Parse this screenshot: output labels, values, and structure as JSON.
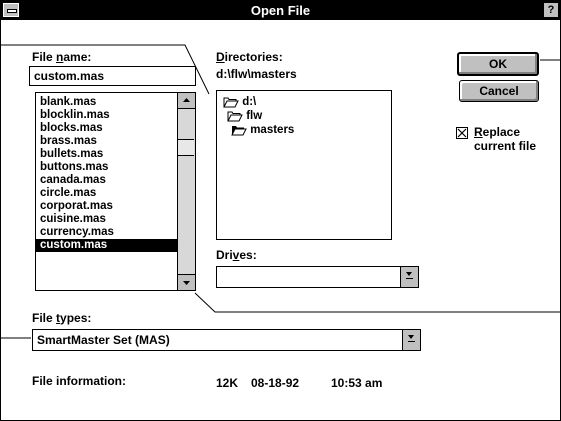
{
  "window": {
    "title": "Open File"
  },
  "file_name": {
    "label_pre": "File ",
    "label_u": "n",
    "label_post": "ame:",
    "value": "custom.mas",
    "items": [
      "blank.mas",
      "blocklin.mas",
      "blocks.mas",
      "brass.mas",
      "bullets.mas",
      "buttons.mas",
      "canada.mas",
      "circle.mas",
      "corporat.mas",
      "cuisine.mas",
      "currency.mas",
      "custom.mas"
    ],
    "selected_index": 11
  },
  "directories": {
    "label_pre": "",
    "label_u": "D",
    "label_post": "irectories:",
    "path": "d:\\flw\\masters",
    "tree": [
      "d:\\",
      "flw",
      "masters"
    ]
  },
  "drives": {
    "label_pre": "Dri",
    "label_u": "v",
    "label_post": "es:",
    "value": ""
  },
  "file_types": {
    "label_pre": "File ",
    "label_u": "t",
    "label_post": "ypes:",
    "value": "SmartMaster Set (MAS)"
  },
  "file_info": {
    "label": "File information:",
    "size": "12K",
    "date": "08-18-92",
    "time": "10:53 am"
  },
  "buttons": {
    "ok": "OK",
    "cancel": "Cancel"
  },
  "replace": {
    "label_u": "R",
    "label_line1_rest": "eplace",
    "label_line2": "current file",
    "checked": true
  }
}
